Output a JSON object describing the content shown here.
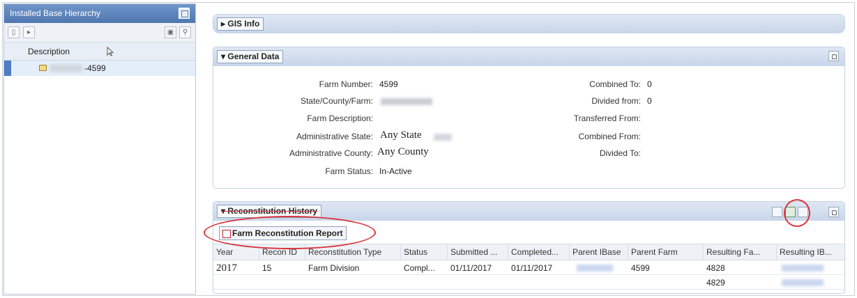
{
  "left_panel": {
    "title": "Installed Base Hierarchy",
    "column_header": "Description",
    "tree_item": "-4599"
  },
  "gis": {
    "label": "GIS Info"
  },
  "general": {
    "label": "General Data",
    "fields_left": [
      {
        "key": "Farm Number:",
        "value": "4599"
      },
      {
        "key": "State/County/Farm:",
        "value": ""
      },
      {
        "key": "Farm Description:",
        "value": ""
      },
      {
        "key": "Administrative State:",
        "value": "Any State"
      },
      {
        "key": "Administrative County:",
        "value": "Any County"
      },
      {
        "key": "Farm Status:",
        "value": "In-Active"
      }
    ],
    "fields_right": [
      {
        "key": "Combined To:",
        "value": "0"
      },
      {
        "key": "Divided from:",
        "value": "0"
      },
      {
        "key": "Transferred From:",
        "value": ""
      },
      {
        "key": "Combined From:",
        "value": ""
      },
      {
        "key": "Divided To:",
        "value": ""
      }
    ]
  },
  "recon": {
    "label": "Reconstitution History",
    "report_button": "Farm Reconstitution Report",
    "columns": [
      "Year",
      "Recon ID",
      "Reconstitution Type",
      "Status",
      "Submitted ...",
      "Completed...",
      "Parent IBase",
      "Parent Farm",
      "Resulting Fa...",
      "Resulting IB..."
    ],
    "rows": [
      {
        "year": "2017",
        "recon_id": "15",
        "type": "Farm Division",
        "status": "Compl...",
        "submitted": "01/11/2017",
        "completed": "01/11/2017",
        "parent_farm": "4599",
        "resulting_farm": "4828"
      },
      {
        "resulting_farm": "4829"
      }
    ]
  },
  "colors": {
    "header_blue": "#4f77b0",
    "highlight_red": "#d9343b",
    "section_bar": "#c8d6ea"
  }
}
